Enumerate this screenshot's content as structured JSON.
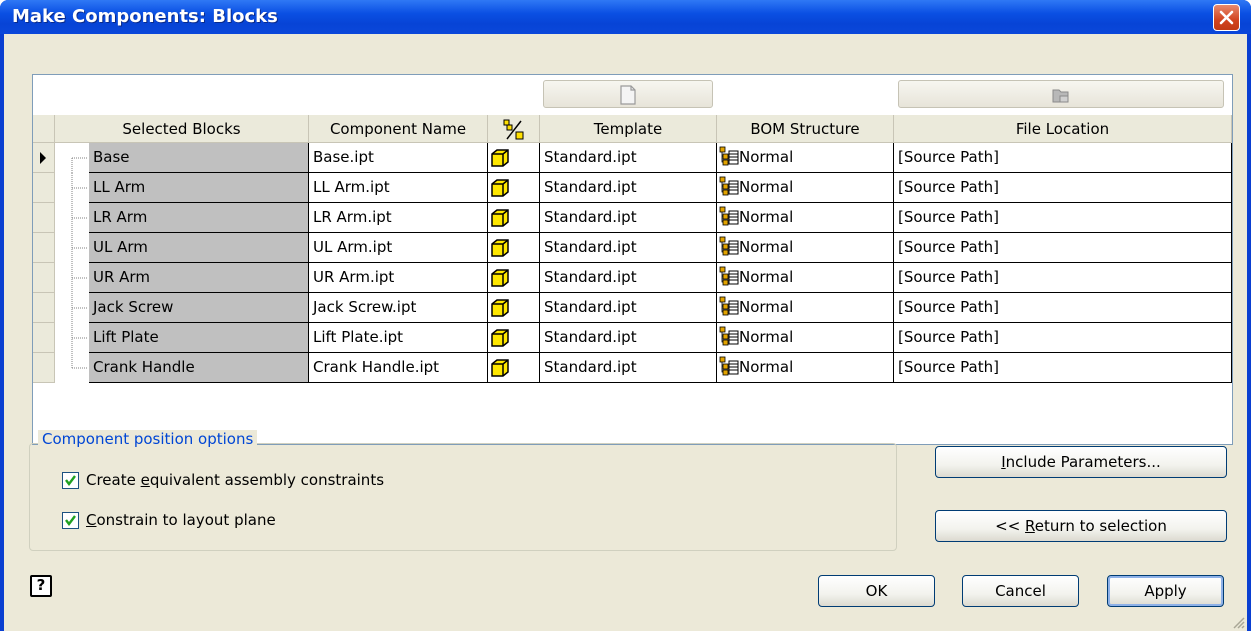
{
  "window": {
    "title": "Make Components: Blocks"
  },
  "grid": {
    "headers": {
      "selected_blocks": "Selected Blocks",
      "component_name": "Component Name",
      "template": "Template",
      "bom_structure": "BOM Structure",
      "file_location": "File Location"
    },
    "rows": [
      {
        "block": "Base",
        "component": "Base.ipt",
        "template": "Standard.ipt",
        "bom": "Normal",
        "location": "[Source Path]"
      },
      {
        "block": "LL Arm",
        "component": "LL Arm.ipt",
        "template": "Standard.ipt",
        "bom": "Normal",
        "location": "[Source Path]"
      },
      {
        "block": "LR Arm",
        "component": "LR Arm.ipt",
        "template": "Standard.ipt",
        "bom": "Normal",
        "location": "[Source Path]"
      },
      {
        "block": "UL Arm",
        "component": "UL Arm.ipt",
        "template": "Standard.ipt",
        "bom": "Normal",
        "location": "[Source Path]"
      },
      {
        "block": "UR Arm",
        "component": "UR Arm.ipt",
        "template": "Standard.ipt",
        "bom": "Normal",
        "location": "[Source Path]"
      },
      {
        "block": "Jack Screw",
        "component": "Jack Screw.ipt",
        "template": "Standard.ipt",
        "bom": "Normal",
        "location": "[Source Path]"
      },
      {
        "block": "Lift Plate",
        "component": "Lift Plate.ipt",
        "template": "Standard.ipt",
        "bom": "Normal",
        "location": "[Source Path]"
      },
      {
        "block": "Crank Handle",
        "component": "Crank Handle.ipt",
        "template": "Standard.ipt",
        "bom": "Normal",
        "location": "[Source Path]"
      }
    ]
  },
  "position_options": {
    "group_label": "Component position options",
    "equivalent_constraints": {
      "label_pre": "Create ",
      "mnemonic": "e",
      "label_post": "quivalent assembly constraints",
      "checked": true
    },
    "layout_plane": {
      "label_pre": "",
      "mnemonic": "C",
      "label_post": "onstrain to layout plane",
      "checked": true
    }
  },
  "buttons": {
    "include_parameters": {
      "mnemonic": "I",
      "rest": "nclude Parameters..."
    },
    "return_to_selection": {
      "pre": "<< ",
      "mnemonic": "R",
      "rest": "eturn to selection"
    },
    "ok": "OK",
    "cancel": "Cancel",
    "apply": "Apply",
    "help": "?"
  },
  "colors": {
    "titlebar": "#0a4fe3",
    "dialog_bg": "#ece9d8",
    "selected_block_bg": "#c0c0c0",
    "group_label": "#0046d5"
  },
  "icons": {
    "template_button": "blank-document-icon",
    "location_button": "folder-icon",
    "part_column_header": "component-type-icon",
    "part_cell": "part-cube-icon",
    "bom": "bom-structure-icon",
    "row_pointer": "current-row-arrow-icon",
    "close": "close-icon",
    "help": "help-icon"
  }
}
